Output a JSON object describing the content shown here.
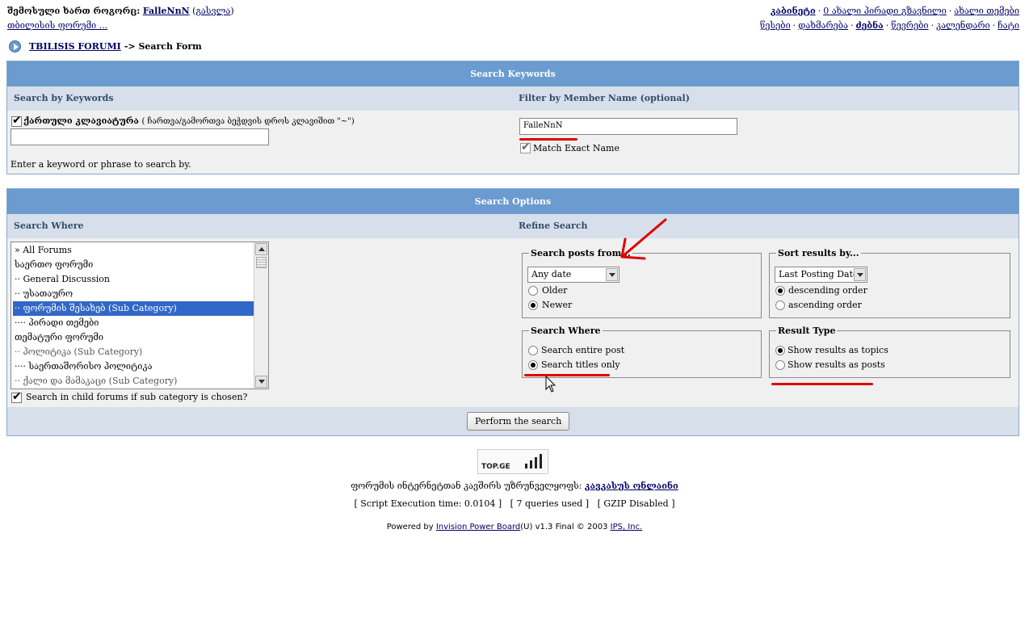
{
  "header": {
    "logged_in_label": "შემოსული ხართ როგორც:",
    "username": "FalleNnN",
    "logout_open": "(",
    "logout_label": "გასვლა",
    "logout_close": ")",
    "forum_home_label": "თბილისის ფორუმი ...",
    "top_links_1": [
      "კაბინეტი",
      "0 ახალი პირადი გზავნილი",
      "ახალი თემები"
    ],
    "top_links_2": [
      "წესები",
      "დახმარება",
      "ძებნა",
      "წევრები",
      "კალენდარი",
      "ჩატი"
    ]
  },
  "breadcrumb": {
    "home": "TBILISIS FORUMI",
    "trail": "-> Search Form"
  },
  "keywords_panel": {
    "title": "Search Keywords",
    "left_heading": "Search by Keywords",
    "right_heading": "Filter by Member Name (optional)",
    "georgian_keyboard_label": "ქართული კლავიატურა",
    "georgian_keyboard_hint": "( ჩართვა/გამორთვა ბეჭდვის დროს კლავიშით \"~\")",
    "keyword_value": "",
    "keyword_hint": "Enter a keyword or phrase to search by.",
    "member_name_value": "FalleNnN",
    "exact_name_label": "Match Exact Name"
  },
  "options_panel": {
    "title": "Search Options",
    "left_heading": "Search Where",
    "right_heading": "Refine Search",
    "forums": [
      {
        "label": "» All Forums",
        "selected": false,
        "dim": false
      },
      {
        "label": "საერთო ფორუმი",
        "selected": false,
        "dim": false
      },
      {
        "label": "·· General Discussion",
        "selected": false,
        "dim": false
      },
      {
        "label": "·· უსათაურო",
        "selected": false,
        "dim": false
      },
      {
        "label": "·· ფორუმის შესახებ (Sub Category)",
        "selected": true,
        "dim": false
      },
      {
        "label": "···· პირადი თემები",
        "selected": false,
        "dim": false
      },
      {
        "label": "თემატური ფორუმი",
        "selected": false,
        "dim": false
      },
      {
        "label": "·· პოლიტიკა (Sub Category)",
        "selected": false,
        "dim": true
      },
      {
        "label": "···· საერთაშორისო პოლიტიკა",
        "selected": false,
        "dim": false
      },
      {
        "label": "·· ქალი და მამაკაცი (Sub Category)",
        "selected": false,
        "dim": true
      }
    ],
    "child_forums_label": "Search in child forums if sub category is chosen?",
    "posts_from": {
      "legend": "Search posts from...",
      "selected": "Any date",
      "older": "Older",
      "newer": "Newer"
    },
    "sort_by": {
      "legend": "Sort results by...",
      "selected": "Last Posting Date",
      "desc": "descending order",
      "asc": "ascending order"
    },
    "search_where": {
      "legend": "Search Where",
      "entire": "Search entire post",
      "titles": "Search titles only"
    },
    "result_type": {
      "legend": "Result Type",
      "topics": "Show results as topics",
      "posts": "Show results as posts"
    },
    "submit_label": "Perform the search"
  },
  "footer": {
    "logo_text": "TOP.GE",
    "sponsor_text": "ფორუმის ინტერნეტთან კავშირს უზრუნველყოფს:",
    "sponsor_link": "კავკასუს ონლაინი",
    "stats": "[ Script Execution time: 0.0104 ]   [ 7 queries used ]   [ GZIP Disabled ]",
    "powered_prefix": "Powered by",
    "powered_link": "Invision Power Board",
    "powered_mid": "(U) v1.3 Final © 2003",
    "ips_link": "IPS, Inc."
  },
  "colors": {
    "header_blue": "#6b9bcf",
    "subheader": "#d6dfea",
    "selection": "#3167c6",
    "annotation_red": "#e00000"
  }
}
